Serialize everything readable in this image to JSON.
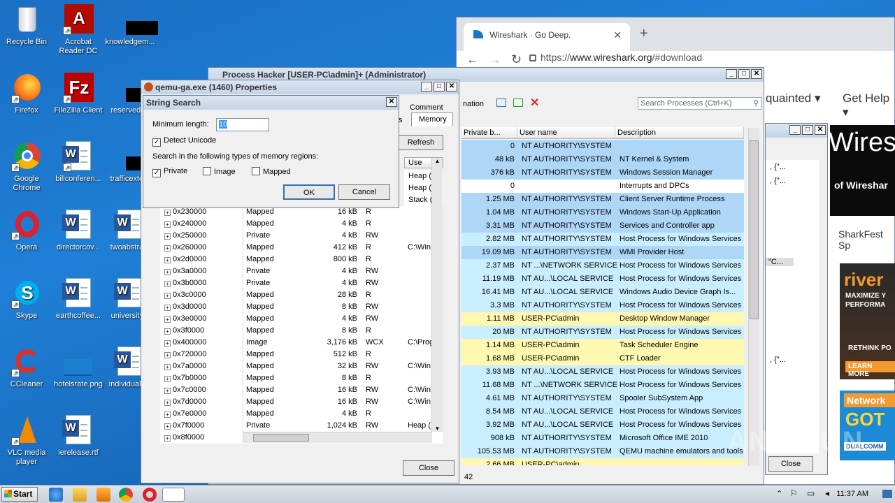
{
  "desktop": {
    "icons": [
      {
        "label": "Recycle Bin"
      },
      {
        "label": "Acrobat Reader DC"
      },
      {
        "label": "knowledgem..."
      },
      {
        "label": "Firefox"
      },
      {
        "label": "FileZilla Client"
      },
      {
        "label": "reservedt..."
      },
      {
        "label": "Google Chrome"
      },
      {
        "label": "billconferen..."
      },
      {
        "label": "trafficexte..."
      },
      {
        "label": "Opera"
      },
      {
        "label": "directorcov..."
      },
      {
        "label": "twoabstra..."
      },
      {
        "label": "Skype"
      },
      {
        "label": "earthcoffee..."
      },
      {
        "label": "university..."
      },
      {
        "label": "CCleaner"
      },
      {
        "label": "hotelsrate.png"
      },
      {
        "label": "individuals..."
      },
      {
        "label": "VLC media player"
      },
      {
        "label": "ierelease.rtf"
      }
    ]
  },
  "browser": {
    "tab_title": "Wireshark · Go Deep.",
    "tab_close": "✕",
    "new_tab": "+",
    "url_prefix": "https://",
    "url_domain": "www.wireshark.org",
    "url_suffix": "/#download",
    "nav_acquainted": "quainted ▾",
    "nav_help": "Get Help ▾",
    "hero_big": "Wires",
    "hero_sub": "of Wireshar",
    "sharkfest": "SharkFest Sp",
    "ad1_title": "river",
    "ad1_line1": "MAXIMIZE Y",
    "ad1_line2": "PERFORMA",
    "ad1_line3": "RETHINK PO",
    "ad1_cta": "LEARN MORE",
    "ad2_head": "Network",
    "ad2_big": "GOT",
    "ad2_brand": "DUALCOMM"
  },
  "process_hacker": {
    "title": "Process Hacker [USER-PC\\admin]+ (Administrator)",
    "toolbar_partial": "nation",
    "search_placeholder": "Search Processes (Ctrl+K)",
    "columns": {
      "private": "Private b...",
      "user": "User name",
      "desc": "Description"
    },
    "status_count": "42",
    "rows": [
      {
        "priv": "0",
        "user": "NT AUTHORITY\\SYSTEM",
        "desc": ""
      },
      {
        "priv": "48 kB",
        "user": "NT AUTHORITY\\SYSTEM",
        "desc": "NT Kernel & System"
      },
      {
        "priv": "376 kB",
        "user": "NT AUTHORITY\\SYSTEM",
        "desc": "Windows Session Manager"
      },
      {
        "priv": "0",
        "user": "",
        "desc": "Interrupts and DPCs"
      },
      {
        "priv": "1.25 MB",
        "user": "NT AUTHORITY\\SYSTEM",
        "desc": "Client Server Runtime Process"
      },
      {
        "priv": "1.04 MB",
        "user": "NT AUTHORITY\\SYSTEM",
        "desc": "Windows Start-Up Application"
      },
      {
        "priv": "3.31 MB",
        "user": "NT AUTHORITY\\SYSTEM",
        "desc": "Services and Controller app"
      },
      {
        "priv": "2.82 MB",
        "user": "NT AUTHORITY\\SYSTEM",
        "desc": "Host Process for Windows Services"
      },
      {
        "priv": "19.09 MB",
        "user": "NT AUTHORITY\\SYSTEM",
        "desc": "WMI Provider Host"
      },
      {
        "priv": "2.37 MB",
        "user": "NT ...\\NETWORK SERVICE",
        "desc": "Host Process for Windows Services"
      },
      {
        "priv": "11.19 MB",
        "user": "NT AU...\\LOCAL SERVICE",
        "desc": "Host Process for Windows Services"
      },
      {
        "priv": "16.41 MB",
        "user": "NT AU...\\LOCAL SERVICE",
        "desc": "Windows Audio Device Graph Is..."
      },
      {
        "priv": "3.3 MB",
        "user": "NT AUTHORITY\\SYSTEM",
        "desc": "Host Process for Windows Services"
      },
      {
        "priv": "1.11 MB",
        "user": "USER-PC\\admin",
        "desc": "Desktop Window Manager"
      },
      {
        "priv": "20 MB",
        "user": "NT AUTHORITY\\SYSTEM",
        "desc": "Host Process for Windows Services"
      },
      {
        "priv": "1.14 MB",
        "user": "USER-PC\\admin",
        "desc": "Task Scheduler Engine"
      },
      {
        "priv": "1.68 MB",
        "user": "USER-PC\\admin",
        "desc": "CTF Loader"
      },
      {
        "priv": "3.93 MB",
        "user": "NT AU...\\LOCAL SERVICE",
        "desc": "Host Process for Windows Services"
      },
      {
        "priv": "11.68 MB",
        "user": "NT ...\\NETWORK SERVICE",
        "desc": "Host Process for Windows Services"
      },
      {
        "priv": "4.61 MB",
        "user": "NT AUTHORITY\\SYSTEM",
        "desc": "Spooler SubSystem App"
      },
      {
        "priv": "8.54 MB",
        "user": "NT AU...\\LOCAL SERVICE",
        "desc": "Host Process for Windows Services"
      },
      {
        "priv": "3.92 MB",
        "user": "NT AU...\\LOCAL SERVICE",
        "desc": "Host Process for Windows Services"
      },
      {
        "priv": "908 kB",
        "user": "NT AUTHORITY\\SYSTEM",
        "desc": "Microsoft Office IME 2010"
      },
      {
        "priv": "105.53 MB",
        "user": "NT AUTHORITY\\SYSTEM",
        "desc": "QEMU machine emulators and tools"
      },
      {
        "priv": "2.66 MB",
        "user": "USER-PC\\admin",
        "desc": ""
      }
    ],
    "partial_s": "s",
    "partial_s2": "s"
  },
  "side_window": {
    "close_label": "Close",
    "text1": ", {\"...",
    "text2": ", {\"...",
    "text3": "\"C...",
    "text4": ", {\"..."
  },
  "properties": {
    "title": "qemu-ga.exe (1460) Properties",
    "tab_comment": "Comment",
    "tab_memory": "Memory",
    "tab_s": "s",
    "refresh": "Refresh",
    "close": "Close",
    "use_col": "Use",
    "pre_rows": [
      {
        "use": "Heap (I"
      },
      {
        "use": "Heap (I"
      },
      {
        "use": "Stack (I"
      }
    ],
    "rows": [
      {
        "addr": "0x230000",
        "type": "Mapped",
        "size": "16 kB",
        "prot": "R",
        "use": ""
      },
      {
        "addr": "0x240000",
        "type": "Mapped",
        "size": "4 kB",
        "prot": "R",
        "use": ""
      },
      {
        "addr": "0x250000",
        "type": "Private",
        "size": "4 kB",
        "prot": "RW",
        "use": ""
      },
      {
        "addr": "0x260000",
        "type": "Mapped",
        "size": "412 kB",
        "prot": "R",
        "use": "C:\\Win"
      },
      {
        "addr": "0x2d0000",
        "type": "Mapped",
        "size": "800 kB",
        "prot": "R",
        "use": ""
      },
      {
        "addr": "0x3a0000",
        "type": "Private",
        "size": "4 kB",
        "prot": "RW",
        "use": ""
      },
      {
        "addr": "0x3b0000",
        "type": "Private",
        "size": "4 kB",
        "prot": "RW",
        "use": ""
      },
      {
        "addr": "0x3c0000",
        "type": "Mapped",
        "size": "28 kB",
        "prot": "R",
        "use": ""
      },
      {
        "addr": "0x3d0000",
        "type": "Mapped",
        "size": "8 kB",
        "prot": "RW",
        "use": ""
      },
      {
        "addr": "0x3e0000",
        "type": "Mapped",
        "size": "4 kB",
        "prot": "RW",
        "use": ""
      },
      {
        "addr": "0x3f0000",
        "type": "Mapped",
        "size": "8 kB",
        "prot": "R",
        "use": ""
      },
      {
        "addr": "0x400000",
        "type": "Image",
        "size": "3,176 kB",
        "prot": "WCX",
        "use": "C:\\Prog"
      },
      {
        "addr": "0x720000",
        "type": "Mapped",
        "size": "512 kB",
        "prot": "R",
        "use": ""
      },
      {
        "addr": "0x7a0000",
        "type": "Mapped",
        "size": "32 kB",
        "prot": "RW",
        "use": "C:\\Win"
      },
      {
        "addr": "0x7b0000",
        "type": "Mapped",
        "size": "8 kB",
        "prot": "R",
        "use": ""
      },
      {
        "addr": "0x7c0000",
        "type": "Mapped",
        "size": "16 kB",
        "prot": "RW",
        "use": "C:\\Win"
      },
      {
        "addr": "0x7d0000",
        "type": "Mapped",
        "size": "16 kB",
        "prot": "RW",
        "use": "C:\\Win"
      },
      {
        "addr": "0x7e0000",
        "type": "Mapped",
        "size": "4 kB",
        "prot": "R",
        "use": ""
      },
      {
        "addr": "0x7f0000",
        "type": "Private",
        "size": "1,024 kB",
        "prot": "RW",
        "use": "Heap (I"
      },
      {
        "addr": "0x8f0000",
        "type": "",
        "size": "",
        "prot": "",
        "use": ""
      }
    ]
  },
  "string_search": {
    "title": "String Search",
    "min_length_label": "Minimum length:",
    "min_length_value": "10",
    "detect_unicode": "Detect Unicode",
    "regions_label": "Search in the following types of memory regions:",
    "private": "Private",
    "image": "Image",
    "mapped": "Mapped",
    "ok": "OK",
    "cancel": "Cancel",
    "close_x": "✕"
  },
  "taskbar": {
    "start": "Start",
    "time": "11:37 AM"
  },
  "watermark": "ANY RUN"
}
